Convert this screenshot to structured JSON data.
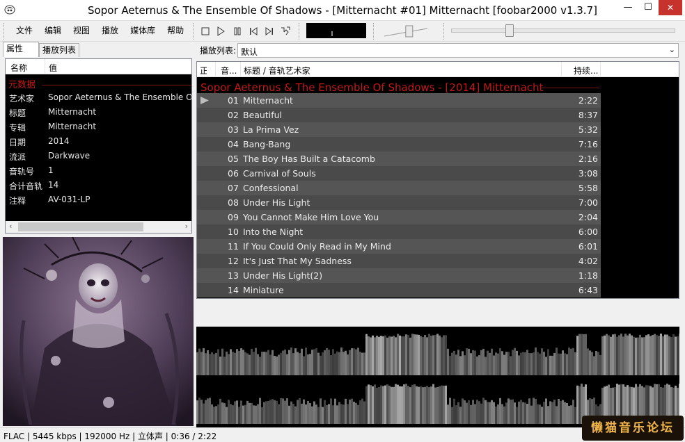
{
  "window": {
    "title": "Sopor Aeternus & The Ensemble Of Shadows - [Mitternacht #01] Mitternacht   [foobar2000 v1.3.7]",
    "minimize": "—",
    "maximize": "☐",
    "close": "✕"
  },
  "menu": [
    "文件",
    "编辑",
    "视图",
    "播放",
    "媒体库",
    "帮助"
  ],
  "left_tabs": {
    "properties": "属性",
    "playlists": "播放列表"
  },
  "properties": {
    "col_name": "名称",
    "col_value": "值",
    "group": "元数据",
    "rows": [
      {
        "key": "艺术家",
        "value": "Sopor Aeternus & The Ensemble Of Shadows"
      },
      {
        "key": "标题",
        "value": "Mitternacht"
      },
      {
        "key": "专辑",
        "value": "Mitternacht"
      },
      {
        "key": "日期",
        "value": "2014"
      },
      {
        "key": "流派",
        "value": "Darkwave"
      },
      {
        "key": "音轨号",
        "value": "1"
      },
      {
        "key": "合计音轨",
        "value": "14"
      },
      {
        "key": "注释",
        "value": "AV-031-LP"
      }
    ]
  },
  "playlist_selector": {
    "label": "播放列表:",
    "value": "默认"
  },
  "playlist": {
    "columns": {
      "status": "正...",
      "track": "音...",
      "title": "标题 / 音轨艺术家",
      "duration": "持续..."
    },
    "group_header": "Sopor Aeternus & The Ensemble Of Shadows - [2014] Mitternacht",
    "tracks": [
      {
        "no": "01",
        "title": "Mitternacht",
        "duration": "2:22",
        "playing": true
      },
      {
        "no": "02",
        "title": "Beautiful",
        "duration": "8:37"
      },
      {
        "no": "03",
        "title": "La Prima Vez",
        "duration": "5:32"
      },
      {
        "no": "04",
        "title": "Bang-Bang",
        "duration": "7:16"
      },
      {
        "no": "05",
        "title": "The Boy Has Built a Catacomb",
        "duration": "2:16"
      },
      {
        "no": "06",
        "title": "Carnival of Souls",
        "duration": "3:08"
      },
      {
        "no": "07",
        "title": "Confessional",
        "duration": "5:58"
      },
      {
        "no": "08",
        "title": "Under His Light",
        "duration": "7:00"
      },
      {
        "no": "09",
        "title": "You Cannot Make Him Love You",
        "duration": "2:04"
      },
      {
        "no": "10",
        "title": "Into the Night",
        "duration": "6:00"
      },
      {
        "no": "11",
        "title": "If You Could Only Read in My Mind",
        "duration": "6:01"
      },
      {
        "no": "12",
        "title": "It's Just That My Sadness",
        "duration": "4:02"
      },
      {
        "no": "13",
        "title": "Under His Light(2)",
        "duration": "1:18"
      },
      {
        "no": "14",
        "title": "Miniature",
        "duration": "6:43"
      }
    ]
  },
  "playback": {
    "seek_fraction": 0.25,
    "volume_fraction": 0.55
  },
  "status": "FLAC | 5445 kbps | 192000 Hz | 立体声 | 0:36 / 2:22",
  "watermark": "懒猫音乐论坛",
  "colors": {
    "accent_red": "#c21818",
    "row_even": "#555555",
    "row_odd": "#4a4a4a"
  }
}
